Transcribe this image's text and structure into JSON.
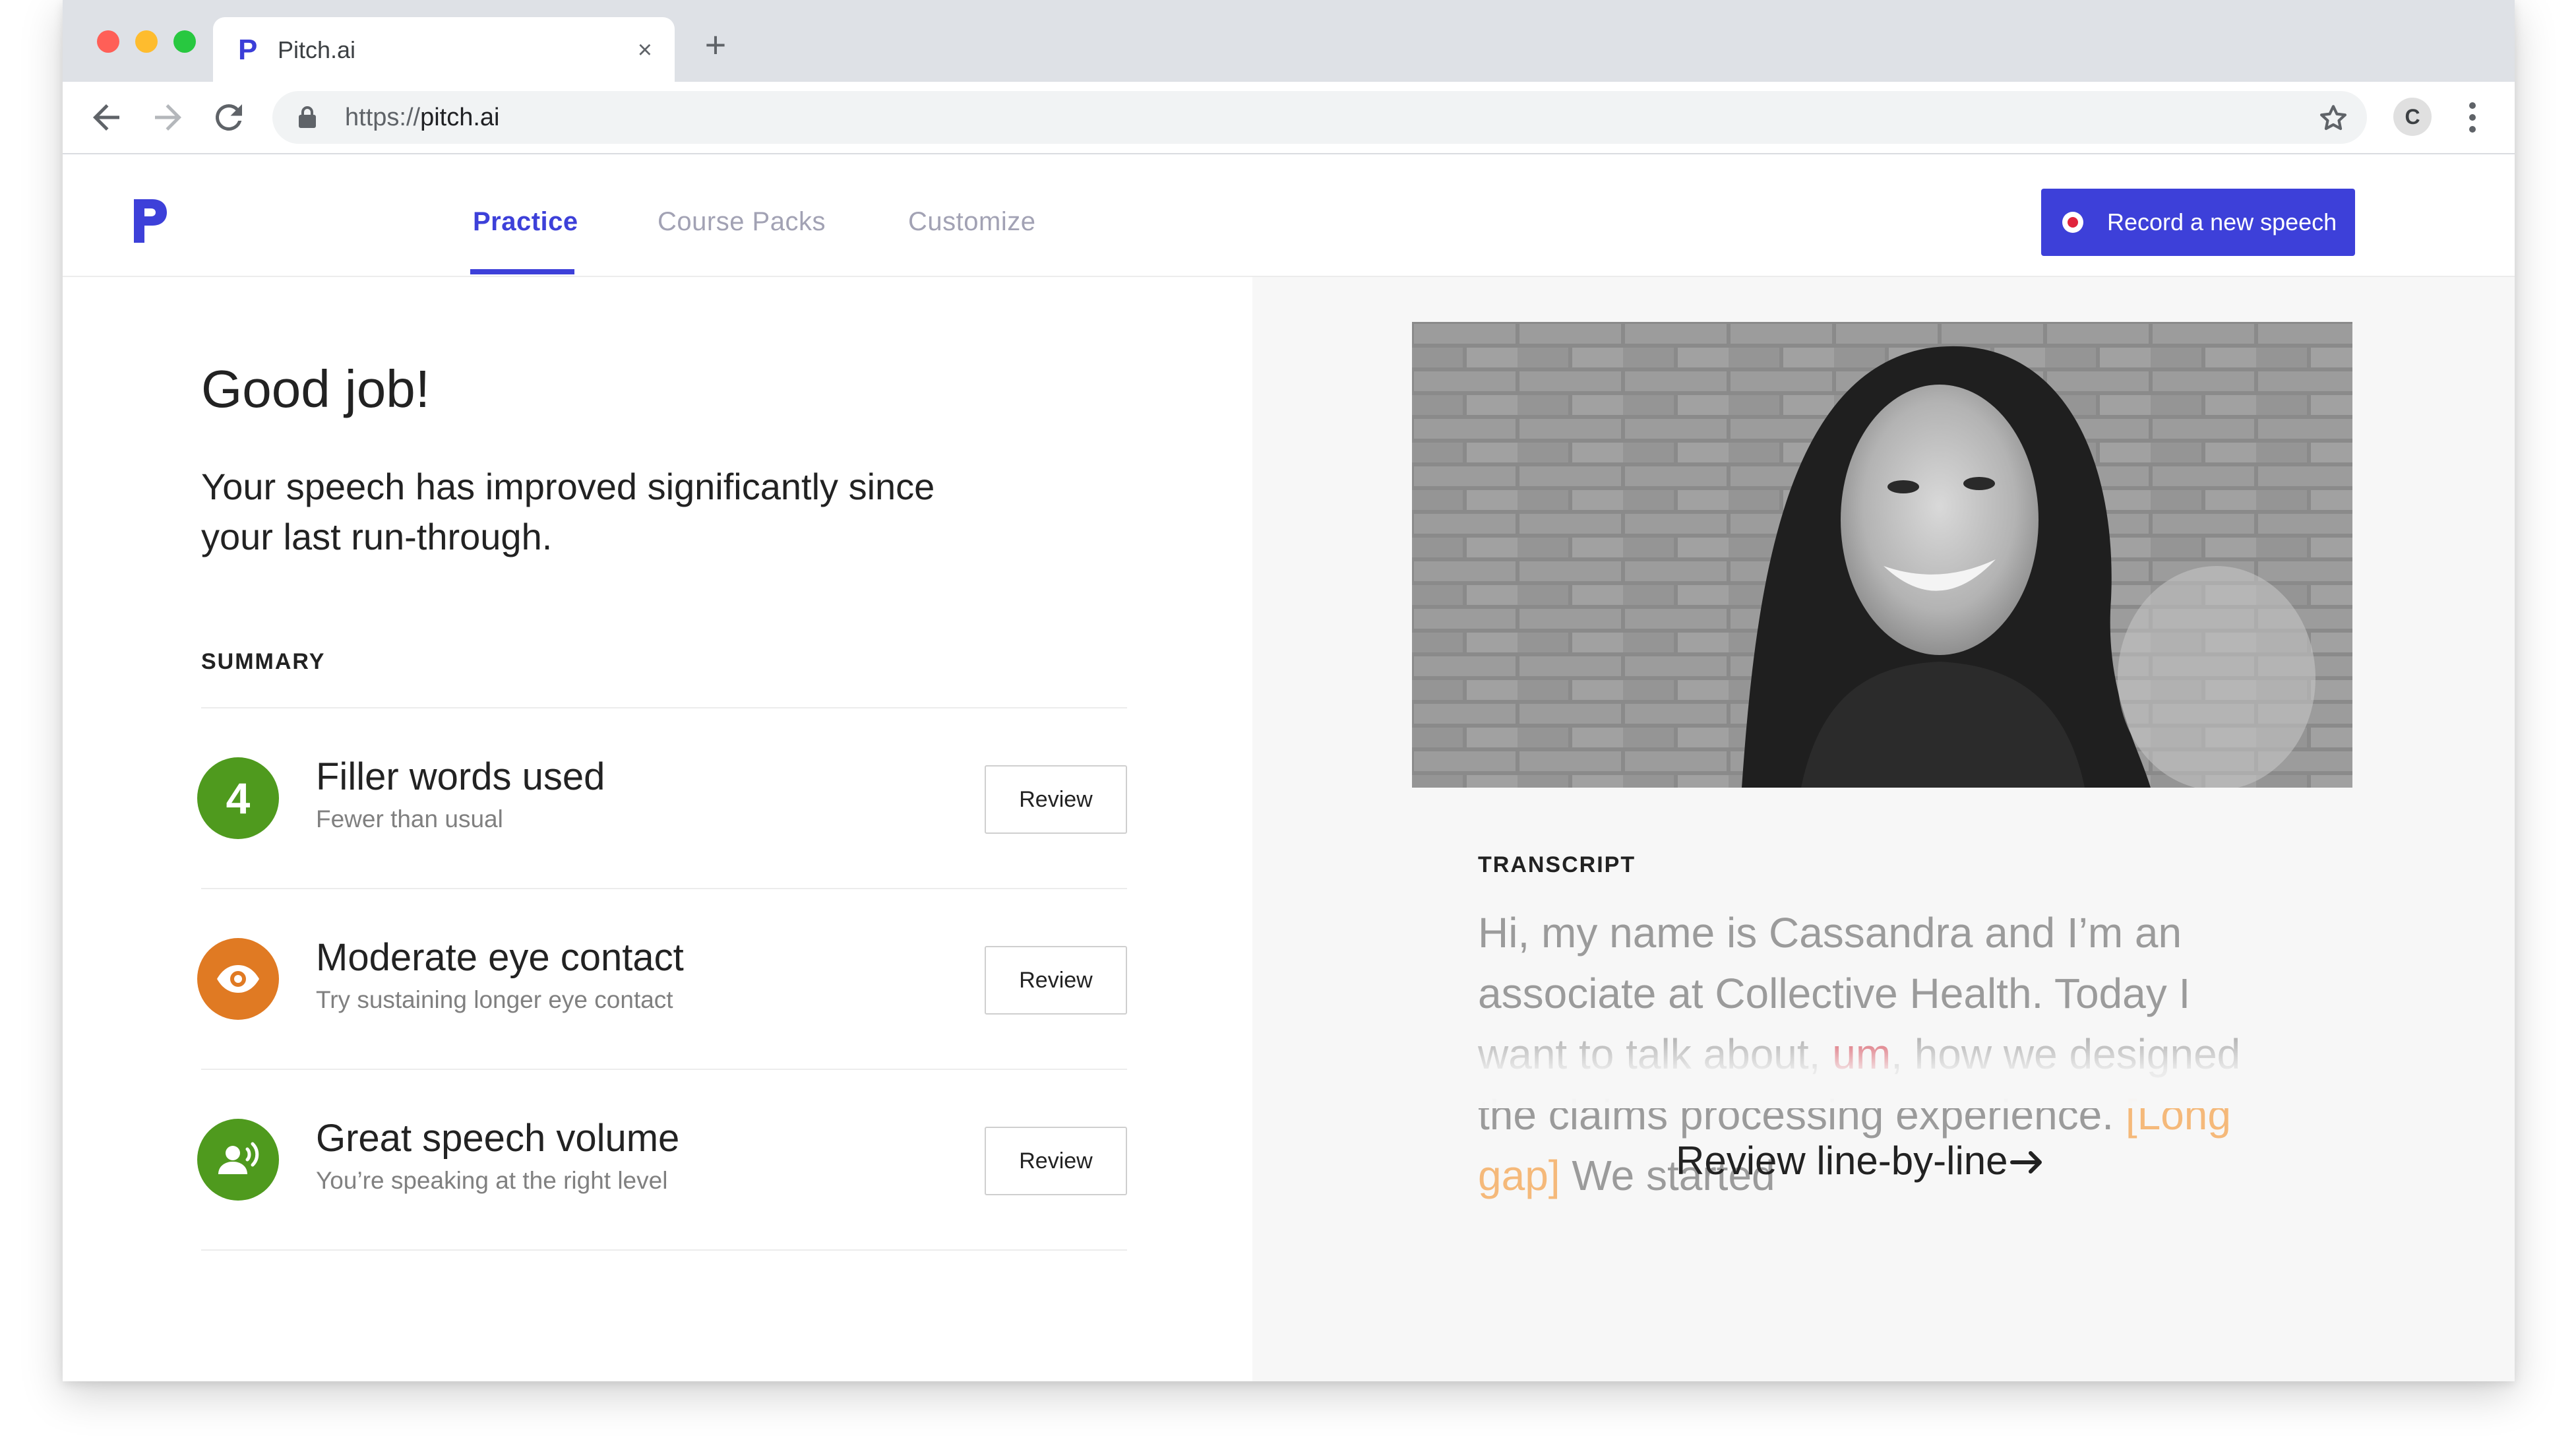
{
  "browser": {
    "tab_title": "Pitch.ai",
    "close_glyph": "×",
    "new_tab_glyph": "+",
    "url_scheme": "https://",
    "url_host": "pitch.ai",
    "profile_initial": "C"
  },
  "header": {
    "logo_letter": "P",
    "nav": [
      {
        "label": "Practice",
        "active": true
      },
      {
        "label": "Course Packs",
        "active": false
      },
      {
        "label": "Customize",
        "active": false
      }
    ],
    "record_label": "Record a new speech"
  },
  "main": {
    "headline": "Good job!",
    "subhead": "Your speech has improved significantly since your last run-through.",
    "summary_label": "SUMMARY",
    "items": [
      {
        "icon": "number-badge",
        "badge": "4",
        "title": "Filler words used",
        "subtitle": "Fewer than usual",
        "button": "Review",
        "color": "#4f9a1e"
      },
      {
        "icon": "eye-icon",
        "title": "Moderate eye contact",
        "subtitle": "Try sustaining longer eye contact",
        "button": "Review",
        "color": "#e07a23"
      },
      {
        "icon": "speaker-voice-icon",
        "title": "Great speech volume",
        "subtitle": "You’re speaking at the right level",
        "button": "Review",
        "color": "#4f9a1e"
      }
    ]
  },
  "side": {
    "transcript_label": "TRANSCRIPT",
    "transcript_part1": "Hi, my name is Cassandra and I’m an associate at Collective Health. Today I want to talk about, ",
    "transcript_filler": "um",
    "transcript_part2": ", how we designed the claims processing experience. ",
    "transcript_gap": "[Long gap]",
    "transcript_part3": " We started",
    "review_link": "Review line-by-line"
  },
  "colors": {
    "brand": "#3d40d9",
    "good": "#4f9a1e",
    "warning": "#e07a23",
    "filler": "#d23b4a",
    "gap": "#f5b97a"
  }
}
